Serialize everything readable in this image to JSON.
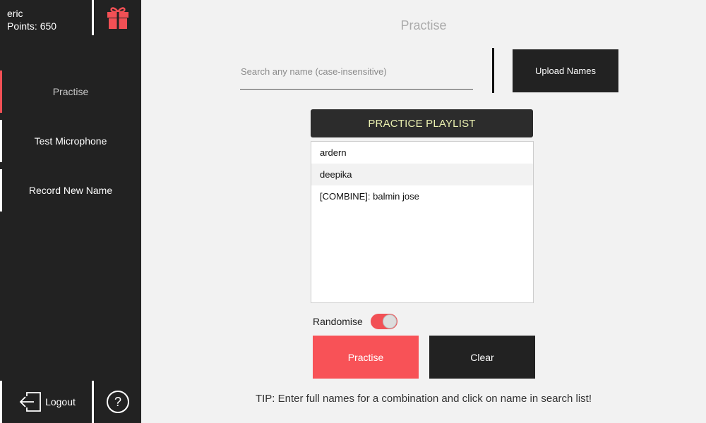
{
  "user": {
    "name": "eric",
    "points": "Points: 650"
  },
  "sidebar": {
    "items": [
      {
        "label": "Practise",
        "active": true
      },
      {
        "label": "Test Microphone",
        "active": false
      },
      {
        "label": "Record New Name",
        "active": false
      }
    ],
    "logout_label": "Logout"
  },
  "main": {
    "title": "Practise",
    "search": {
      "placeholder": "Search any name (case-insensitive)",
      "value": ""
    },
    "upload_label": "Upload Names",
    "playlist": {
      "header": "PRACTICE PLAYLIST",
      "items": [
        "ardern",
        "deepika",
        "[COMBINE]: balmin jose"
      ]
    },
    "randomise": {
      "label": "Randomise",
      "on": true
    },
    "practise_label": "Practise",
    "clear_label": "Clear",
    "tip": "TIP: Enter full names for a combination and click on name in search list!"
  },
  "icons": {
    "gift": "gift-icon",
    "logout": "logout-icon",
    "help": "help-icon"
  },
  "colors": {
    "accent": "#f25055",
    "sidebar": "#222222",
    "background": "#f2f2f2"
  }
}
